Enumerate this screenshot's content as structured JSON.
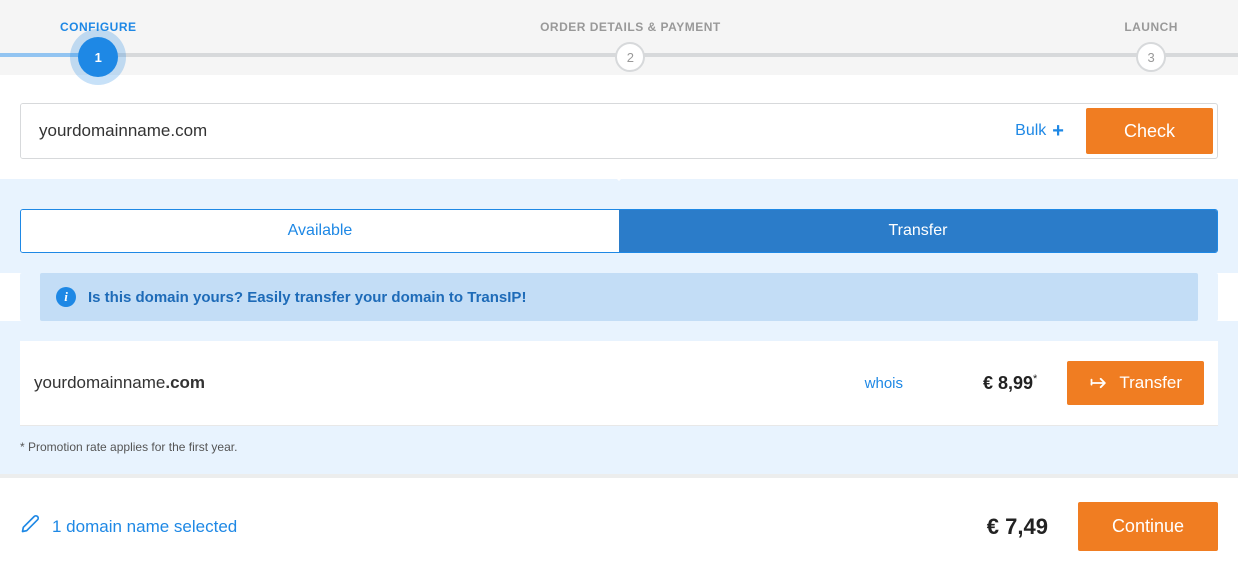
{
  "steps": {
    "s1": {
      "label": "CONFIGURE",
      "num": "1"
    },
    "s2": {
      "label": "ORDER DETAILS & PAYMENT",
      "num": "2"
    },
    "s3": {
      "label": "LAUNCH",
      "num": "3"
    }
  },
  "search": {
    "value": "yourdomainname.com",
    "bulk_label": "Bulk",
    "check_label": "Check"
  },
  "tabs": {
    "available": "Available",
    "transfer": "Transfer"
  },
  "info": {
    "text": "Is this domain yours? Easily transfer your domain to TransIP!"
  },
  "result": {
    "sld": "yourdomainname",
    "tld": ".com",
    "whois": "whois",
    "price": "€ 8,99",
    "asterisk": "*",
    "transfer_label": "Transfer"
  },
  "promo": "* Promotion rate applies for the first year.",
  "footer": {
    "selected": "1 domain name selected",
    "total": "€ 7,49",
    "continue_label": "Continue"
  }
}
